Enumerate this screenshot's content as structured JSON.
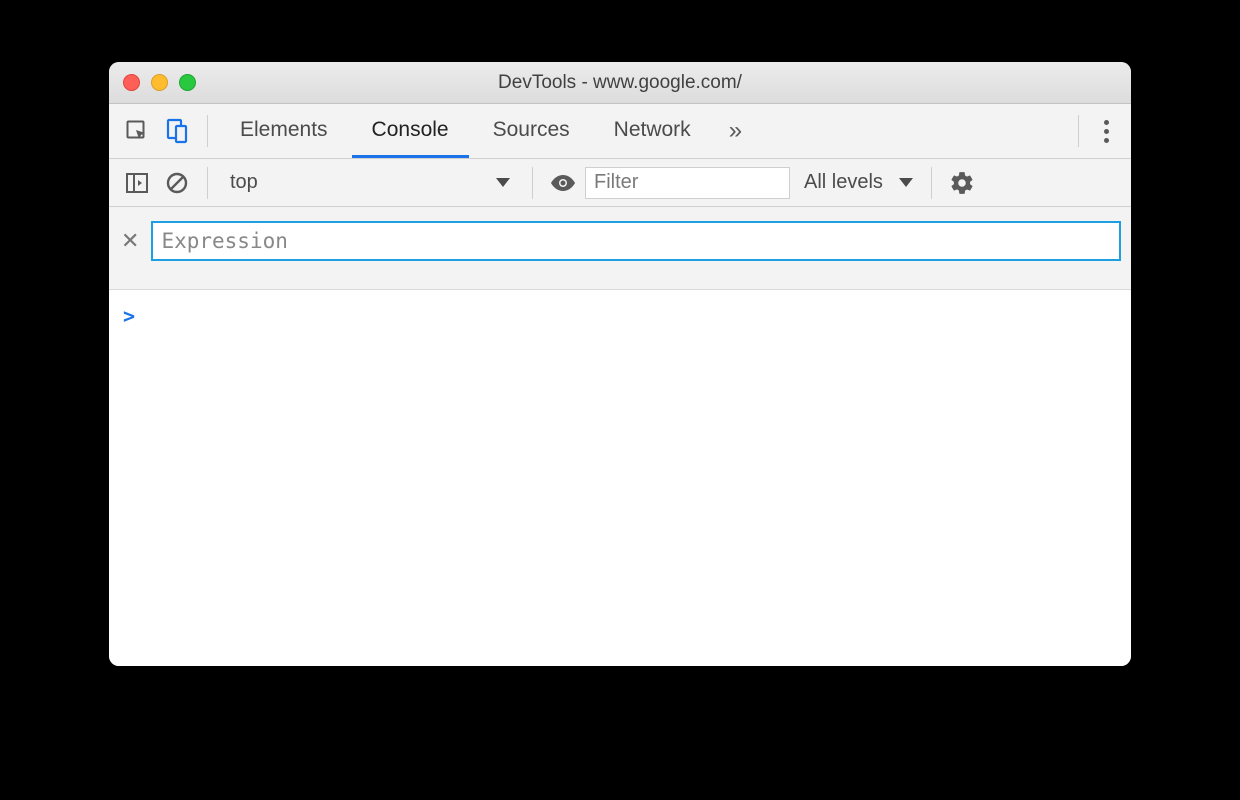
{
  "window": {
    "title": "DevTools - www.google.com/"
  },
  "tabs": {
    "items": [
      "Elements",
      "Console",
      "Sources",
      "Network"
    ],
    "active": "Console"
  },
  "consoleBar": {
    "context": "top",
    "filter_placeholder": "Filter",
    "levels_label": "All levels"
  },
  "expression": {
    "placeholder": "Expression"
  },
  "prompt": ">"
}
